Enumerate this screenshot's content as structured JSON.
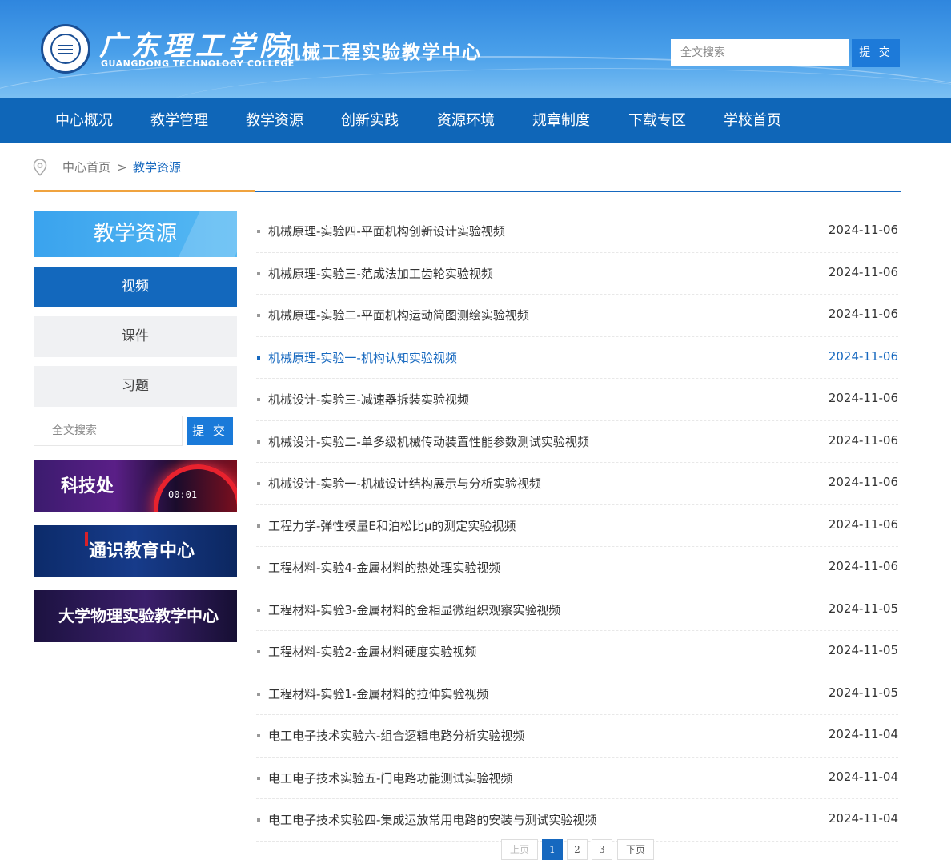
{
  "header": {
    "school_name": "广东理工学院",
    "school_name_en": "GUANGDONG TECHNOLOGY COLLEGE",
    "center_name": "机械工程实验教学中心",
    "search_placeholder": "全文搜索",
    "search_button": "提 交"
  },
  "nav": {
    "items": [
      "中心概况",
      "教学管理",
      "教学资源",
      "创新实践",
      "资源环境",
      "规章制度",
      "下载专区",
      "学校首页"
    ]
  },
  "breadcrumb": {
    "home": "中心首页",
    "separator": ">",
    "current": "教学资源"
  },
  "sidebar": {
    "title": "教学资源",
    "items": [
      {
        "label": "视频",
        "active": true
      },
      {
        "label": "课件",
        "active": false
      },
      {
        "label": "习题",
        "active": false
      }
    ],
    "search_placeholder": "全文搜索",
    "search_button": "提 交",
    "banners": [
      "科技处",
      "通识教育中心",
      "大学物理实验教学中心"
    ],
    "banner1_dial": "00:01"
  },
  "list": [
    {
      "title": "机械原理-实验四-平面机构创新设计实验视频",
      "date": "2024-11-06"
    },
    {
      "title": "机械原理-实验三-范成法加工齿轮实验视频",
      "date": "2024-11-06"
    },
    {
      "title": "机械原理-实验二-平面机构运动简图测绘实验视频",
      "date": "2024-11-06"
    },
    {
      "title": "机械原理-实验一-机构认知实验视频",
      "date": "2024-11-06",
      "highlight": true
    },
    {
      "title": "机械设计-实验三-减速器拆装实验视频",
      "date": "2024-11-06"
    },
    {
      "title": "机械设计-实验二-单多级机械传动装置性能参数测试实验视频",
      "date": "2024-11-06"
    },
    {
      "title": "机械设计-实验一-机械设计结构展示与分析实验视频",
      "date": "2024-11-06"
    },
    {
      "title": "工程力学-弹性模量E和泊松比μ的测定实验视频",
      "date": "2024-11-06"
    },
    {
      "title": "工程材料-实验4-金属材料的热处理实验视频",
      "date": "2024-11-06"
    },
    {
      "title": "工程材料-实验3-金属材料的金相显微组织观察实验视频",
      "date": "2024-11-05"
    },
    {
      "title": "工程材料-实验2-金属材料硬度实验视频",
      "date": "2024-11-05"
    },
    {
      "title": "工程材料-实验1-金属材料的拉伸实验视频",
      "date": "2024-11-05"
    },
    {
      "title": "电工电子技术实验六-组合逻辑电路分析实验视频",
      "date": "2024-11-04"
    },
    {
      "title": "电工电子技术实验五-门电路功能测试实验视频",
      "date": "2024-11-04"
    },
    {
      "title": "电工电子技术实验四-集成运放常用电路的安装与测试实验视频",
      "date": "2024-11-04"
    }
  ],
  "pager": {
    "prev": "上页",
    "pages": [
      "1",
      "2",
      "3"
    ],
    "current": "1",
    "next": "下页"
  },
  "colors": {
    "nav_bg": "#0f66b8",
    "accent_blue": "#1668bf",
    "accent_orange": "#f0a33f",
    "sidebar_active": "#1368bd"
  }
}
